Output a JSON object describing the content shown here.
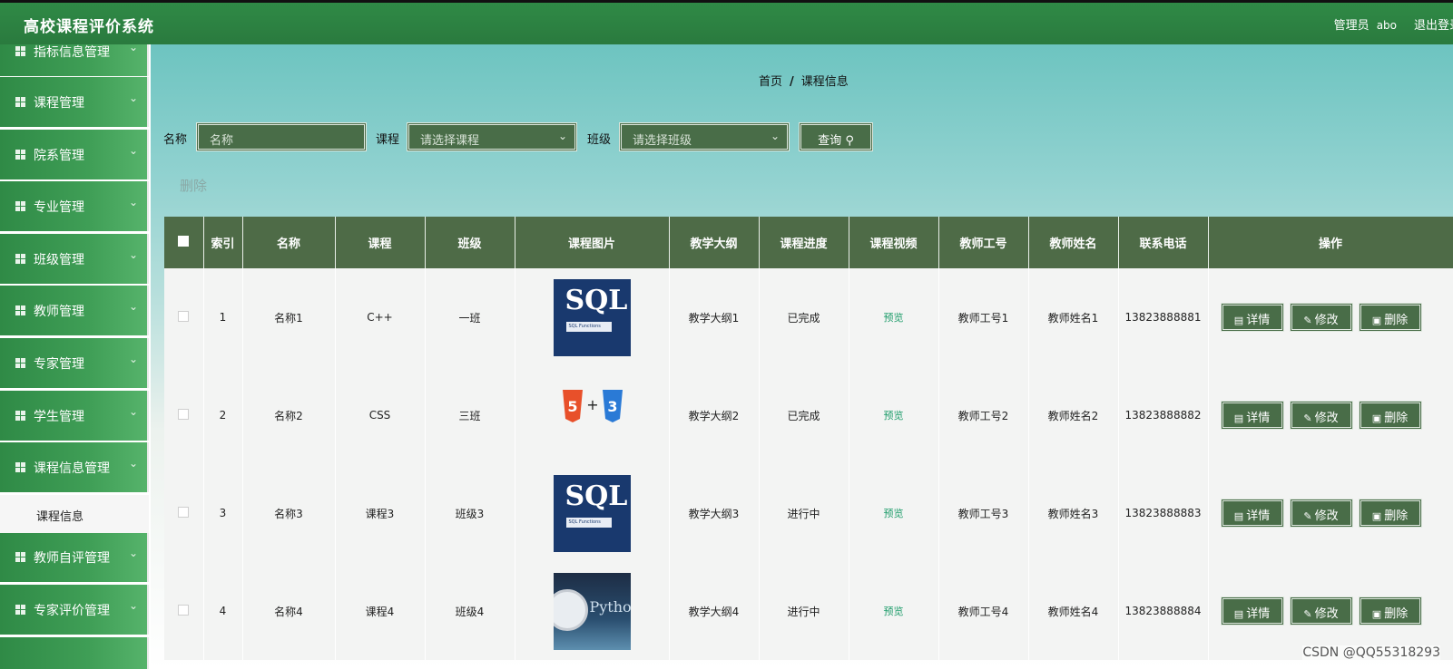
{
  "header": {
    "title": "高校课程评价系统",
    "admin_label": "管理员",
    "username": "abo",
    "logout": "退出登录"
  },
  "sidebar": {
    "items": [
      {
        "label": "指标信息管理",
        "icon": "grid-icon"
      },
      {
        "label": "课程管理",
        "icon": "thumb-icon"
      },
      {
        "label": "院系管理",
        "icon": "clipboard-icon"
      },
      {
        "label": "专业管理",
        "icon": "grid-icon"
      },
      {
        "label": "班级管理",
        "icon": "grid-icon"
      },
      {
        "label": "教师管理",
        "icon": "grid-icon"
      },
      {
        "label": "专家管理",
        "icon": "clipboard-icon"
      },
      {
        "label": "学生管理",
        "icon": "grid-icon"
      },
      {
        "label": "课程信息管理",
        "icon": "monitor-icon"
      },
      {
        "label": "教师自评管理",
        "icon": "chat-icon"
      },
      {
        "label": "专家评价管理",
        "icon": "chat-icon"
      }
    ],
    "active_sub": "课程信息"
  },
  "breadcrumb": {
    "home": "首页",
    "sep": "/",
    "current": "课程信息"
  },
  "search": {
    "name_label": "名称",
    "name_placeholder": "名称",
    "course_label": "课程",
    "course_placeholder": "请选择课程",
    "class_label": "班级",
    "class_placeholder": "请选择班级",
    "query_button": "查询"
  },
  "actions": {
    "delete": "删除"
  },
  "table": {
    "headers": [
      "索引",
      "名称",
      "课程",
      "班级",
      "课程图片",
      "教学大纲",
      "课程进度",
      "课程视频",
      "教师工号",
      "教师姓名",
      "联系电话",
      "操作"
    ],
    "rows": [
      {
        "index": "1",
        "name": "名称1",
        "course": "C++",
        "class": "一班",
        "image": "sql",
        "syllabus": "教学大纲1",
        "progress": "已完成",
        "video": "预览",
        "teacher_id": "教师工号1",
        "teacher_name": "教师姓名1",
        "phone": "13823888881"
      },
      {
        "index": "2",
        "name": "名称2",
        "course": "CSS",
        "class": "三班",
        "image": "html-css",
        "syllabus": "教学大纲2",
        "progress": "已完成",
        "video": "预览",
        "teacher_id": "教师工号2",
        "teacher_name": "教师姓名2",
        "phone": "13823888882"
      },
      {
        "index": "3",
        "name": "名称3",
        "course": "课程3",
        "class": "班级3",
        "image": "sql",
        "syllabus": "教学大纲3",
        "progress": "进行中",
        "video": "预览",
        "teacher_id": "教师工号3",
        "teacher_name": "教师姓名3",
        "phone": "13823888883"
      },
      {
        "index": "4",
        "name": "名称4",
        "course": "课程4",
        "class": "班级4",
        "image": "python",
        "syllabus": "教学大纲4",
        "progress": "进行中",
        "video": "预览",
        "teacher_id": "教师工号4",
        "teacher_name": "教师姓名4",
        "phone": "13823888884"
      }
    ],
    "row_buttons": {
      "detail": "详情",
      "edit": "修改",
      "delete": "删除"
    }
  },
  "images": {
    "sql_big": "SQL",
    "sql_strip": "SQL Functions",
    "python_word": "Python"
  },
  "watermark": "CSDN @QQ55318293",
  "colors": {
    "header": "#2f8a46",
    "button": "#496d48",
    "table_header": "#4e6b47",
    "preview_link": "#1d9c6a"
  }
}
